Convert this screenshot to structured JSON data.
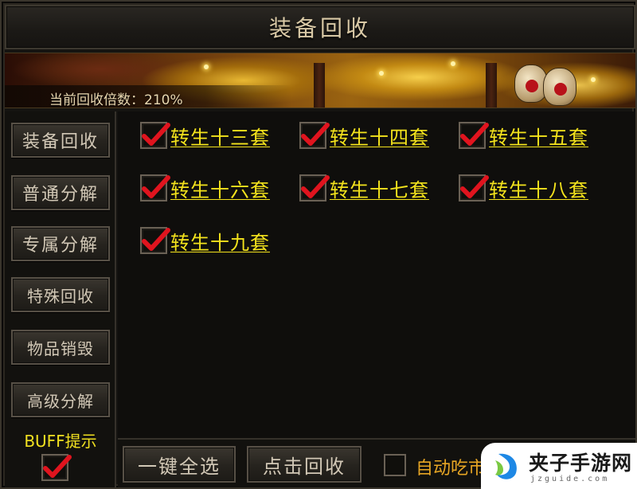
{
  "window": {
    "title": "装备回收"
  },
  "banner": {
    "rate_text": "当前回收倍数：210%"
  },
  "sidebar": {
    "items": [
      {
        "label": "装备回收"
      },
      {
        "label": "普通分解"
      },
      {
        "label": "专属分解"
      },
      {
        "label": "特殊回收"
      },
      {
        "label": "物品销毁"
      },
      {
        "label": "高级分解"
      }
    ],
    "buff_label": "BUFF提示",
    "buff_checked": true
  },
  "options": [
    {
      "label": "转生十三套",
      "checked": true
    },
    {
      "label": "转生十四套",
      "checked": true
    },
    {
      "label": "转生十五套",
      "checked": true
    },
    {
      "label": "转生十六套",
      "checked": true
    },
    {
      "label": "转生十七套",
      "checked": true
    },
    {
      "label": "转生十八套",
      "checked": true
    },
    {
      "label": "转生十九套",
      "checked": true
    }
  ],
  "footer": {
    "select_all": "一键全选",
    "recycle": "点击回收",
    "auto_label": "自动吃市",
    "auto_checked": false
  },
  "watermark": {
    "name": "夹子手游网",
    "url": "jzguide.com"
  },
  "colors": {
    "option_text": "#f3e21c",
    "check_red": "#e0141e",
    "auto_text": "#e8a624"
  }
}
